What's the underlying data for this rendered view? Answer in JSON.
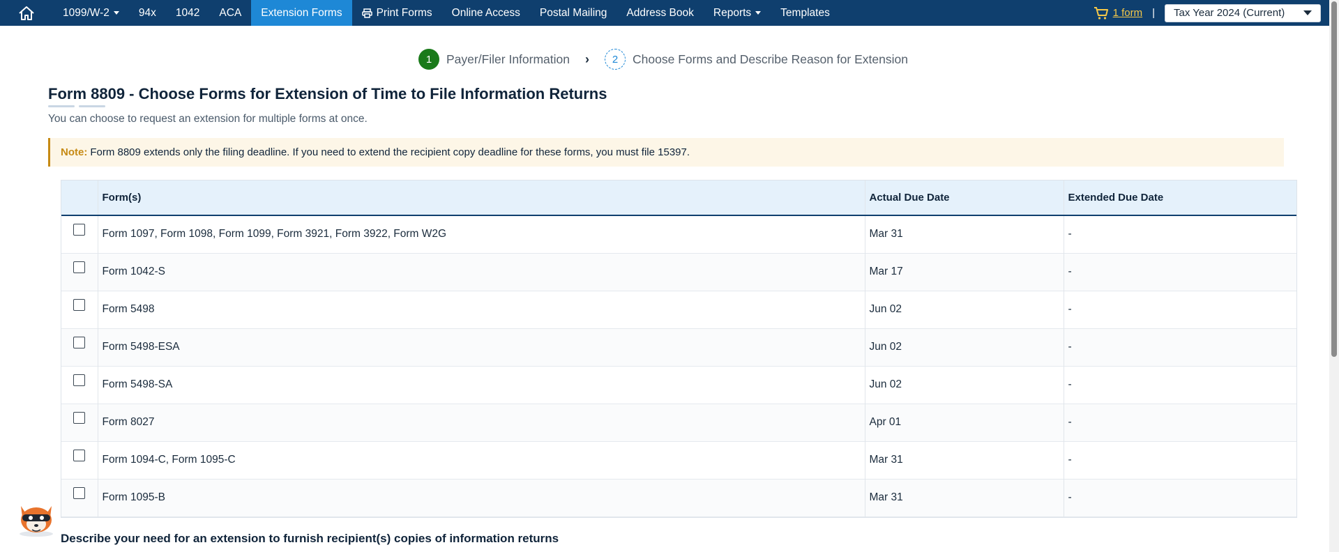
{
  "nav": {
    "items": [
      {
        "label": "1099/W-2",
        "dropdown": true
      },
      {
        "label": "94x"
      },
      {
        "label": "1042"
      },
      {
        "label": "ACA"
      },
      {
        "label": "Extension Forms",
        "active": true
      },
      {
        "label": "Print Forms",
        "icon": "printer-icon"
      },
      {
        "label": "Online Access"
      },
      {
        "label": "Postal Mailing"
      },
      {
        "label": "Address Book"
      },
      {
        "label": "Reports",
        "dropdown": true
      },
      {
        "label": "Templates"
      }
    ],
    "cart_label": "1 form",
    "separator": "|",
    "tax_year": "Tax Year 2024 (Current)"
  },
  "stepper": {
    "steps": [
      {
        "num": "1",
        "label": "Payer/Filer Information",
        "state": "done"
      },
      {
        "num": "2",
        "label": "Choose Forms and Describe Reason for Extension",
        "state": "todo"
      }
    ]
  },
  "page": {
    "title": "Form 8809 - Choose Forms for Extension of Time to File Information Returns",
    "subtitle": "You can choose to request an extension for multiple forms at once.",
    "note_label": "Note:",
    "note_text": "Form 8809 extends only the filing deadline. If you need to extend the recipient copy deadline for these forms, you must file 15397."
  },
  "table": {
    "headers": [
      "Form(s)",
      "Actual Due Date",
      "Extended Due Date"
    ],
    "rows": [
      {
        "forms": "Form 1097, Form 1098, Form 1099, Form 3921, Form 3922, Form W2G",
        "actual": "Mar 31",
        "extended": "-"
      },
      {
        "forms": "Form 1042-S",
        "actual": "Mar 17",
        "extended": "-"
      },
      {
        "forms": "Form 5498",
        "actual": "Jun 02",
        "extended": "-"
      },
      {
        "forms": "Form 5498-ESA",
        "actual": "Jun 02",
        "extended": "-"
      },
      {
        "forms": "Form 5498-SA",
        "actual": "Jun 02",
        "extended": "-"
      },
      {
        "forms": "Form 8027",
        "actual": "Apr 01",
        "extended": "-"
      },
      {
        "forms": "Form 1094-C, Form 1095-C",
        "actual": "Mar 31",
        "extended": "-"
      },
      {
        "forms": "Form 1095-B",
        "actual": "Mar 31",
        "extended": "-"
      }
    ]
  },
  "describe_heading": "Describe your need for an extension to furnish recipient(s) copies of information returns",
  "colors": {
    "nav_bg": "#0f3f6e",
    "nav_active": "#1e88d6",
    "step_done": "#1a7a1a",
    "note_accent": "#c68a14",
    "cart_color": "#f7c948"
  }
}
